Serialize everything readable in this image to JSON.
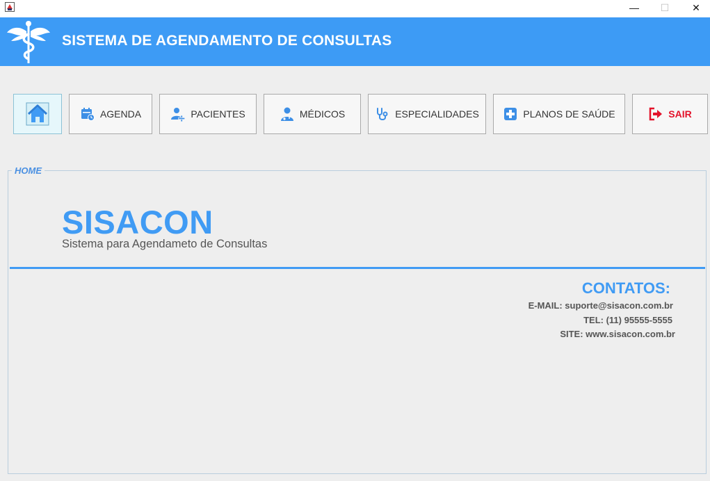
{
  "window": {
    "minimize_glyph": "—",
    "maximize_glyph": "☐",
    "close_glyph": "✕"
  },
  "header": {
    "title": "SISTEMA DE AGENDAMENTO DE CONSULTAS",
    "logo_icon": "caduceus-icon"
  },
  "nav": {
    "home": {
      "icon": "home-icon"
    },
    "agenda": {
      "label": "AGENDA",
      "icon": "calendar-clock-icon"
    },
    "pacientes": {
      "label": "PACIENTES",
      "icon": "add-user-icon"
    },
    "medicos": {
      "label": "MÉDICOS",
      "icon": "doctor-icon"
    },
    "especialidades": {
      "label": "ESPECIALIDADES",
      "icon": "stethoscope-icon"
    },
    "planos": {
      "label": "PLANOS DE SAÚDE",
      "icon": "medical-cross-icon"
    },
    "sair": {
      "label": "SAIR",
      "icon": "exit-icon"
    }
  },
  "panel": {
    "legend": "HOME",
    "brand": "SISACON",
    "subtitle": "Sistema para Agendameto de Consultas",
    "contacts": {
      "title": "CONTATOS:",
      "email": "E-MAIL: suporte@sisacon.com.br",
      "tel": "TEL: (11) 95555-5555",
      "site": "SITE: www.sisacon.com.br"
    }
  },
  "colors": {
    "accent": "#3d9bf5",
    "brand": "#409bf4",
    "danger": "#e3132b",
    "text_muted": "#555555"
  }
}
